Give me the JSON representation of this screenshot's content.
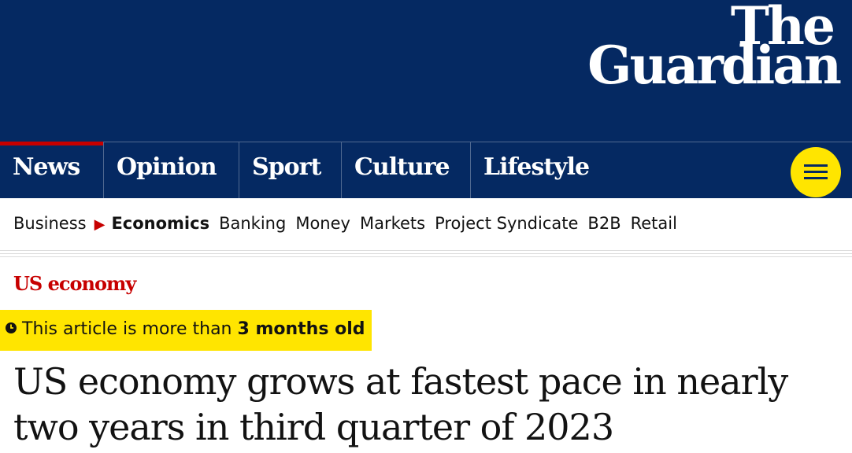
{
  "brand": {
    "line1": "The",
    "line2": "Guardian"
  },
  "nav": {
    "pillars": [
      {
        "label": "News",
        "active": true
      },
      {
        "label": "Opinion",
        "active": false
      },
      {
        "label": "Sport",
        "active": false
      },
      {
        "label": "Culture",
        "active": false
      },
      {
        "label": "Lifestyle",
        "active": false
      }
    ],
    "menu_icon": "hamburger-icon"
  },
  "subnav": {
    "parent": "Business",
    "current": "Economics",
    "items": [
      "Banking",
      "Money",
      "Markets",
      "Project Syndicate",
      "B2B",
      "Retail"
    ]
  },
  "article": {
    "kicker": "US economy",
    "age_warning_prefix": "This article is more than ",
    "age_warning_bold": "3 months old",
    "headline": "US economy grows at fastest pace in nearly two years in third quarter of 2023"
  },
  "colors": {
    "brand_blue": "#052962",
    "news_red": "#c70000",
    "highlight_yellow": "#ffe500"
  }
}
